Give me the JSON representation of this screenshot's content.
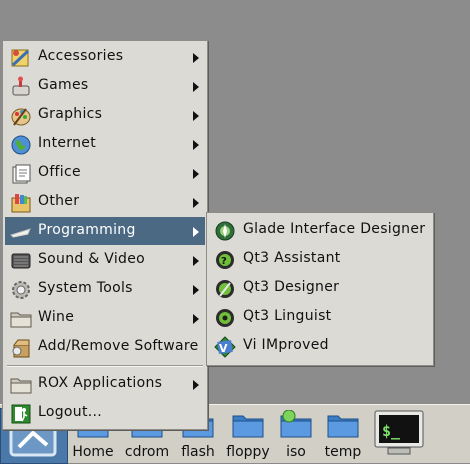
{
  "main_menu": {
    "items": [
      {
        "label": "Accessories",
        "icon": "accessories-icon",
        "submenu": true
      },
      {
        "label": "Games",
        "icon": "games-icon",
        "submenu": true
      },
      {
        "label": "Graphics",
        "icon": "graphics-icon",
        "submenu": true
      },
      {
        "label": "Internet",
        "icon": "internet-globe-icon",
        "submenu": true
      },
      {
        "label": "Office",
        "icon": "office-icon",
        "submenu": true
      },
      {
        "label": "Other",
        "icon": "other-icon",
        "submenu": true
      },
      {
        "label": "Programming",
        "icon": "programming-icon",
        "submenu": true,
        "active": true
      },
      {
        "label": "Sound & Video",
        "icon": "sound-video-icon",
        "submenu": true
      },
      {
        "label": "System Tools",
        "icon": "system-tools-icon",
        "submenu": true
      },
      {
        "label": "Wine",
        "icon": "wine-folder-icon",
        "submenu": true
      },
      {
        "label": "Add/Remove Software",
        "icon": "package-icon",
        "submenu": false
      },
      {
        "label": "ROX Applications",
        "icon": "rox-folder-icon",
        "submenu": true
      },
      {
        "label": "Logout...",
        "icon": "logout-icon",
        "submenu": false
      }
    ]
  },
  "programming_submenu": {
    "items": [
      {
        "label": "Glade Interface Designer",
        "icon": "glade-icon"
      },
      {
        "label": "Qt3 Assistant",
        "icon": "qt-assistant-icon"
      },
      {
        "label": "Qt3 Designer",
        "icon": "qt-designer-icon"
      },
      {
        "label": "Qt3 Linguist",
        "icon": "qt-linguist-icon"
      },
      {
        "label": "Vi IMproved",
        "icon": "vim-icon"
      }
    ]
  },
  "panel": {
    "launchers": [
      {
        "label": "Home",
        "icon": "home-folder-icon"
      },
      {
        "label": "cdrom",
        "icon": "cdrom-folder-icon"
      },
      {
        "label": "flash",
        "icon": "flash-folder-icon"
      },
      {
        "label": "floppy",
        "icon": "floppy-folder-icon"
      },
      {
        "label": "iso",
        "icon": "iso-folder-icon"
      },
      {
        "label": "temp",
        "icon": "temp-folder-icon"
      }
    ],
    "terminal_icon": "terminal-icon"
  },
  "colors": {
    "menu_bg": "#dcdad5",
    "highlight": "#4b6983",
    "desktop": "#8c8c8c",
    "panel": "#d2d0c6"
  }
}
